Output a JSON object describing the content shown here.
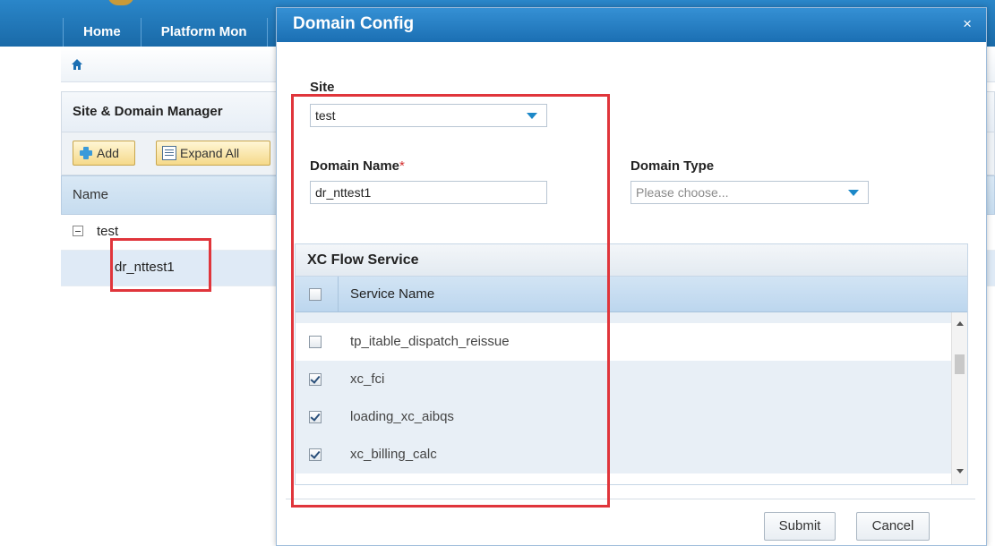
{
  "nav": {
    "items": [
      "Home",
      "Platform Mon"
    ]
  },
  "panel": {
    "title": "Site & Domain Manager"
  },
  "toolbar": {
    "add_label": "Add",
    "expand_label": "Expand All"
  },
  "grid": {
    "header": "Name",
    "tree": [
      {
        "label": "test",
        "level": 0,
        "expanded": true
      },
      {
        "label": "dr_nttest1",
        "level": 1,
        "selected": true
      }
    ]
  },
  "dialog": {
    "title": "Domain Config",
    "close_symbol": "×",
    "site": {
      "label": "Site",
      "value": "test"
    },
    "domain_name": {
      "label": "Domain Name",
      "required_mark": "*",
      "value": "dr_nttest1"
    },
    "domain_type": {
      "label": "Domain Type",
      "placeholder": "Please choose..."
    },
    "services": {
      "title": "XC Flow Service",
      "column_header": "Service Name",
      "header_checked": false,
      "rows": [
        {
          "name": "tp_itable_dispatch_reissue",
          "checked": false
        },
        {
          "name": "xc_fci",
          "checked": true
        },
        {
          "name": "loading_xc_aibqs",
          "checked": true
        },
        {
          "name": "xc_billing_calc",
          "checked": true
        }
      ]
    },
    "buttons": {
      "submit": "Submit",
      "cancel": "Cancel"
    }
  },
  "colors": {
    "header_blue": "#1b6fb3",
    "highlight_red": "#e0353b",
    "selected_row": "#dfeaf6"
  },
  "icons": [
    "home-icon",
    "plus-icon",
    "expand-all-icon",
    "collapse-icon",
    "close-icon",
    "dropdown-arrow-icon",
    "checkbox-icon",
    "scroll-up-icon",
    "scroll-down-icon"
  ]
}
